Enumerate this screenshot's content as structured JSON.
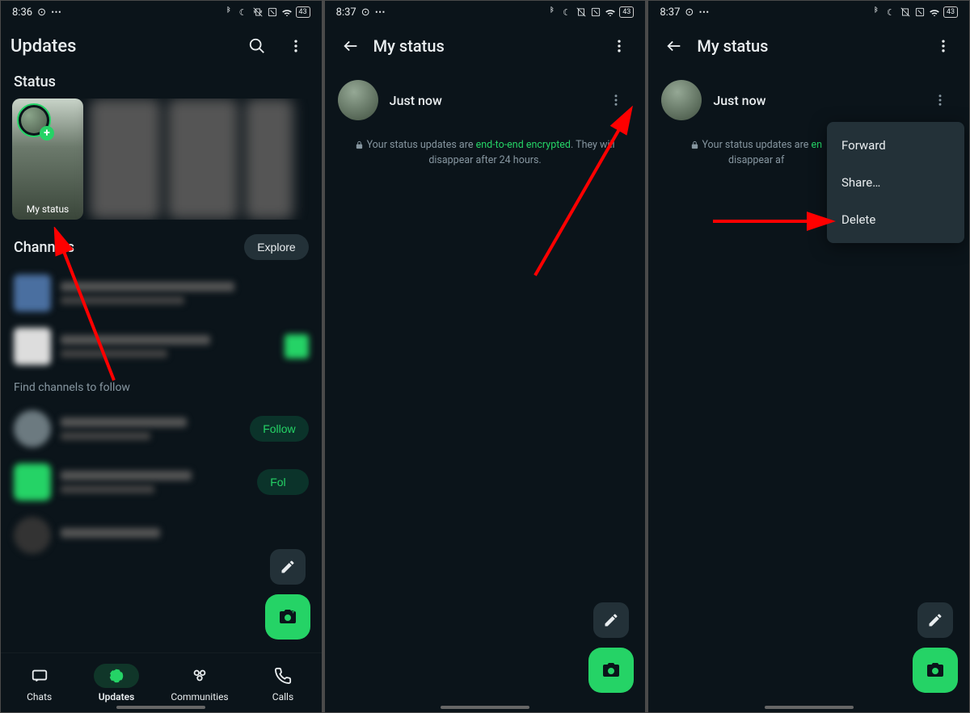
{
  "statusbar": {
    "time1": "8:36",
    "time2": "8:37",
    "time3": "8:37",
    "battery": "43"
  },
  "screen1": {
    "title": "Updates",
    "statusHeading": "Status",
    "myStatusLabel": "My status",
    "channelsHeading": "Channels",
    "exploreLabel": "Explore",
    "findLabel": "Find channels to follow",
    "followLabel": "Follow",
    "nav": {
      "chats": "Chats",
      "updates": "Updates",
      "communities": "Communities",
      "calls": "Calls"
    }
  },
  "screen2": {
    "title": "My status",
    "entryTime": "Just now",
    "encPrefix": "Your status updates are ",
    "encLink": "end-to-end encrypted",
    "encSuffix": ". They will disappear after 24 hours."
  },
  "screen3": {
    "title": "My status",
    "entryTime": "Just now",
    "encPrefix": "Your status updates are ",
    "encLinkTrunc": "en",
    "encSuffixTrunc": "disappear af",
    "menu": {
      "forward": "Forward",
      "share": "Share…",
      "delete": "Delete"
    }
  }
}
